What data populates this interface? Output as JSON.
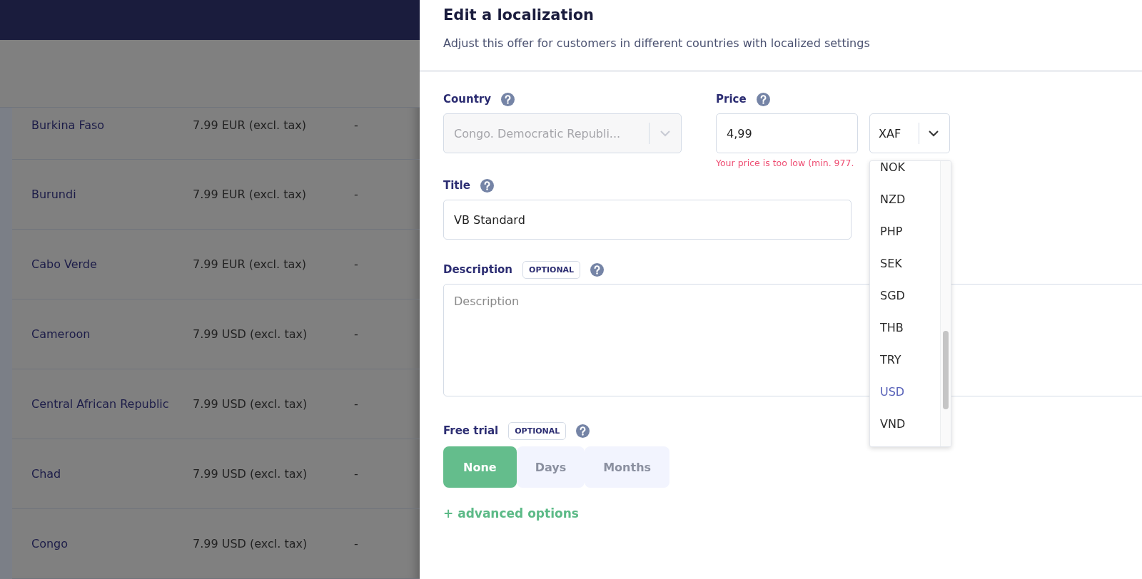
{
  "table": {
    "rows": [
      {
        "country": "Burkina Faso",
        "price": "7.99 EUR (excl. tax)",
        "column_3": "-"
      },
      {
        "country": "Burundi",
        "price": "7.99 EUR (excl. tax)",
        "column_3": "-"
      },
      {
        "country": "Cabo Verde",
        "price": "7.99 EUR (excl. tax)",
        "column_3": "-"
      },
      {
        "country": "Cameroon",
        "price": "7.99 USD (excl. tax)",
        "column_3": "-"
      },
      {
        "country": "Central African Republic",
        "price": "7.99 USD (excl. tax)",
        "column_3": "-"
      },
      {
        "country": "Chad",
        "price": "7.99 USD (excl. tax)",
        "column_3": "-"
      },
      {
        "country": "Congo",
        "price": "7.99 USD (excl. tax)",
        "column_3": "-"
      }
    ]
  },
  "panel": {
    "title": "Edit a localization",
    "subtitle": "Adjust this offer for customers in different countries with localized settings",
    "country": {
      "label": "Country",
      "value": "Congo. Democratic Republi...",
      "disabled": true
    },
    "price": {
      "label": "Price",
      "value": "4,99",
      "currency": "XAF",
      "error": "Your price is too low (min. 977.",
      "currency_options": [
        {
          "label": "NOK",
          "selected": false
        },
        {
          "label": "NZD",
          "selected": false
        },
        {
          "label": "PHP",
          "selected": false
        },
        {
          "label": "SEK",
          "selected": false
        },
        {
          "label": "SGD",
          "selected": false
        },
        {
          "label": "THB",
          "selected": false
        },
        {
          "label": "TRY",
          "selected": false
        },
        {
          "label": "USD",
          "selected": true
        },
        {
          "label": "VND",
          "selected": false
        }
      ]
    },
    "title_field": {
      "label": "Title",
      "value": "VB Standard"
    },
    "description": {
      "label": "Description",
      "badge": "OPTIONAL",
      "placeholder": "Description"
    },
    "free_trial": {
      "label": "Free trial",
      "badge": "OPTIONAL",
      "options": [
        {
          "label": "None",
          "selected": true
        },
        {
          "label": "Days",
          "selected": false
        },
        {
          "label": "Months",
          "selected": false
        }
      ]
    },
    "advanced_link": "+ advanced options"
  }
}
